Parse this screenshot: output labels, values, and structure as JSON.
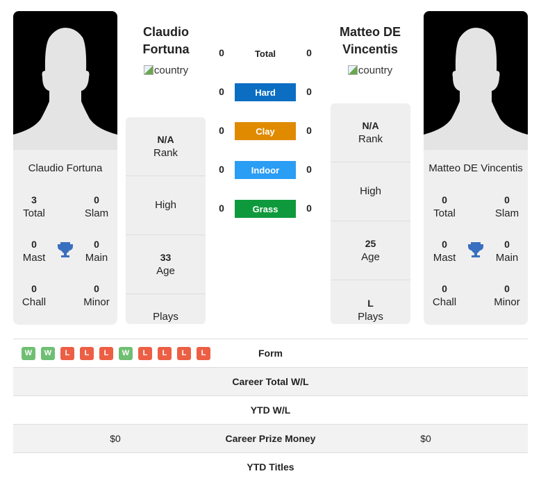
{
  "player1": {
    "name": "Claudio Fortuna",
    "name_line1": "Claudio",
    "name_line2": "Fortuna",
    "flag_alt": "country",
    "titles": {
      "total": "3",
      "slam": "0",
      "mast": "0",
      "main": "0",
      "chall": "0",
      "minor": "0"
    },
    "rank": "N/A",
    "high": "",
    "age": "33",
    "plays": ""
  },
  "player2": {
    "name": "Matteo DE Vincentis",
    "name_line1": "Matteo DE",
    "name_line2": "Vincentis",
    "flag_alt": "country",
    "titles": {
      "total": "0",
      "slam": "0",
      "mast": "0",
      "main": "0",
      "chall": "0",
      "minor": "0"
    },
    "rank": "N/A",
    "high": "",
    "age": "25",
    "plays": "L"
  },
  "labels": {
    "total": "Total",
    "slam": "Slam",
    "mast": "Mast",
    "main": "Main",
    "chall": "Chall",
    "minor": "Minor",
    "rank": "Rank",
    "high": "High",
    "age": "Age",
    "plays": "Plays"
  },
  "surfaces": [
    {
      "label": "Total",
      "p1": "0",
      "p2": "0",
      "color": ""
    },
    {
      "label": "Hard",
      "p1": "0",
      "p2": "0",
      "color": "#0c6ec2"
    },
    {
      "label": "Clay",
      "p1": "0",
      "p2": "0",
      "color": "#e08a00"
    },
    {
      "label": "Indoor",
      "p1": "0",
      "p2": "0",
      "color": "#2a9df4"
    },
    {
      "label": "Grass",
      "p1": "0",
      "p2": "0",
      "color": "#0e9a3c"
    }
  ],
  "form": [
    "W",
    "W",
    "L",
    "L",
    "L",
    "W",
    "L",
    "L",
    "L",
    "L"
  ],
  "bottom": {
    "form_label": "Form",
    "career_wl_label": "Career Total W/L",
    "ytd_wl_label": "YTD W/L",
    "prize_label": "Career Prize Money",
    "prize_p1": "$0",
    "prize_p2": "$0",
    "ytd_titles_label": "YTD Titles"
  }
}
